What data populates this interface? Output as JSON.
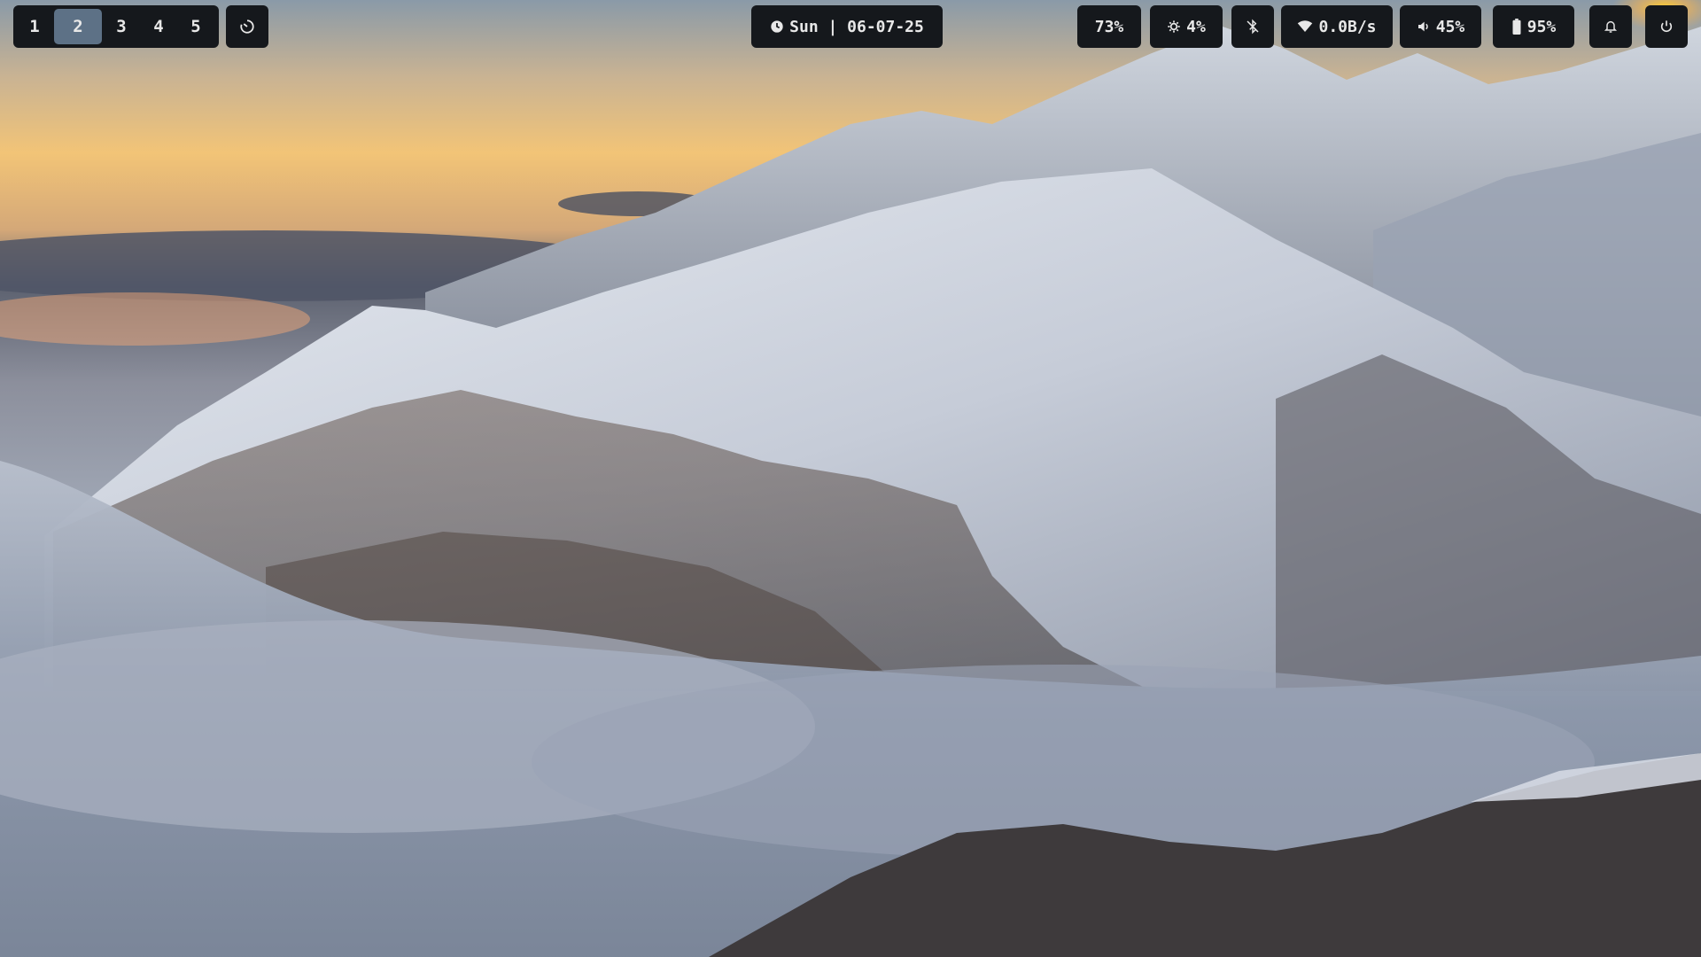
{
  "wallpaper": {
    "description_icon": "mountain-landscape"
  },
  "workspaces": {
    "items": [
      "1",
      "2",
      "3",
      "4",
      "5"
    ],
    "active_index": 1
  },
  "launcher": {
    "icon": "launcher-icon"
  },
  "clock": {
    "icon": "clock-icon",
    "text": "Sun | 06-07-25"
  },
  "status": {
    "cpu": {
      "text": "73%"
    },
    "brightness": {
      "icon": "brightness-icon",
      "text": "4%"
    },
    "bluetooth": {
      "icon": "bluetooth-off-icon"
    },
    "network": {
      "icon": "wifi-icon",
      "text": "0.0B/s"
    },
    "volume": {
      "icon": "volume-icon",
      "text": "45%"
    },
    "battery": {
      "icon": "battery-icon",
      "text": "95%"
    },
    "notifications": {
      "icon": "bell-icon"
    },
    "power": {
      "icon": "power-icon"
    }
  },
  "colors": {
    "bar_bg": "#15181c",
    "active_ws": "#5d7186",
    "text": "#e8e8e8"
  }
}
